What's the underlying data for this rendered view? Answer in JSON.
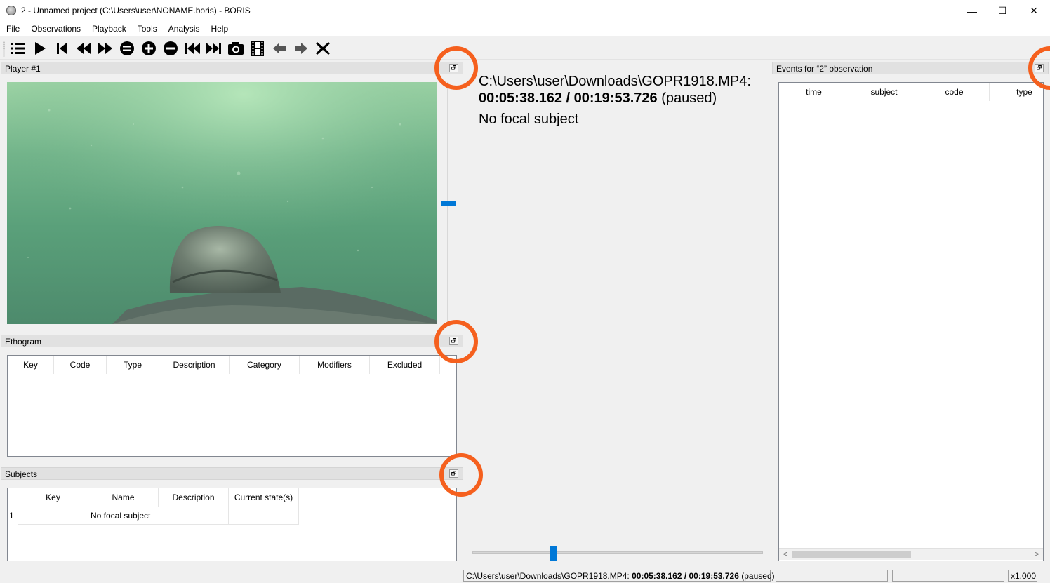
{
  "window": {
    "title": "2 - Unnamed project (C:\\Users\\user\\NONAME.boris) - BORIS",
    "minimize": "—",
    "maximize": "☐",
    "close": "✕"
  },
  "menu": [
    "File",
    "Observations",
    "Playback",
    "Tools",
    "Analysis",
    "Help"
  ],
  "toolbar": {
    "icons": [
      "menu-list",
      "play",
      "jump-to-beginning",
      "rewind",
      "fast-forward",
      "frame-backward",
      "zoom-in",
      "frame-forward",
      "previous-media",
      "next-media",
      "snapshot",
      "frame-by-frame",
      "previous-event",
      "next-event",
      "close-observation"
    ]
  },
  "player": {
    "title": "Player #1",
    "float_button": "🗗",
    "volume_level": 0.5
  },
  "ethogram": {
    "title": "Ethogram",
    "columns": [
      "Key",
      "Code",
      "Type",
      "Description",
      "Category",
      "Modifiers",
      "Excluded"
    ]
  },
  "subjects": {
    "title": "Subjects",
    "columns": [
      "Key",
      "Name",
      "Description",
      "Current state(s)"
    ],
    "rows": [
      {
        "index": "1",
        "key": "",
        "name": "No focal subject",
        "description": "",
        "state": ""
      }
    ]
  },
  "info": {
    "path": "C:\\Users\\user\\Downloads\\GOPR1918.MP4:",
    "time": "00:05:38.162 / 00:19:53.726",
    "state": "(paused)",
    "focal": "No focal subject",
    "position_fraction": 0.28
  },
  "events": {
    "title": "Events for “2” observation",
    "columns": [
      "time",
      "subject",
      "code",
      "type"
    ],
    "scroll_left": "<",
    "scroll_right": ">"
  },
  "statusbar": {
    "path": "C:\\Users\\user\\Downloads\\GOPR1918.MP4:",
    "time": "00:05:38.162 / 00:19:53.726",
    "state": "(paused)",
    "speed": "x1.000"
  }
}
